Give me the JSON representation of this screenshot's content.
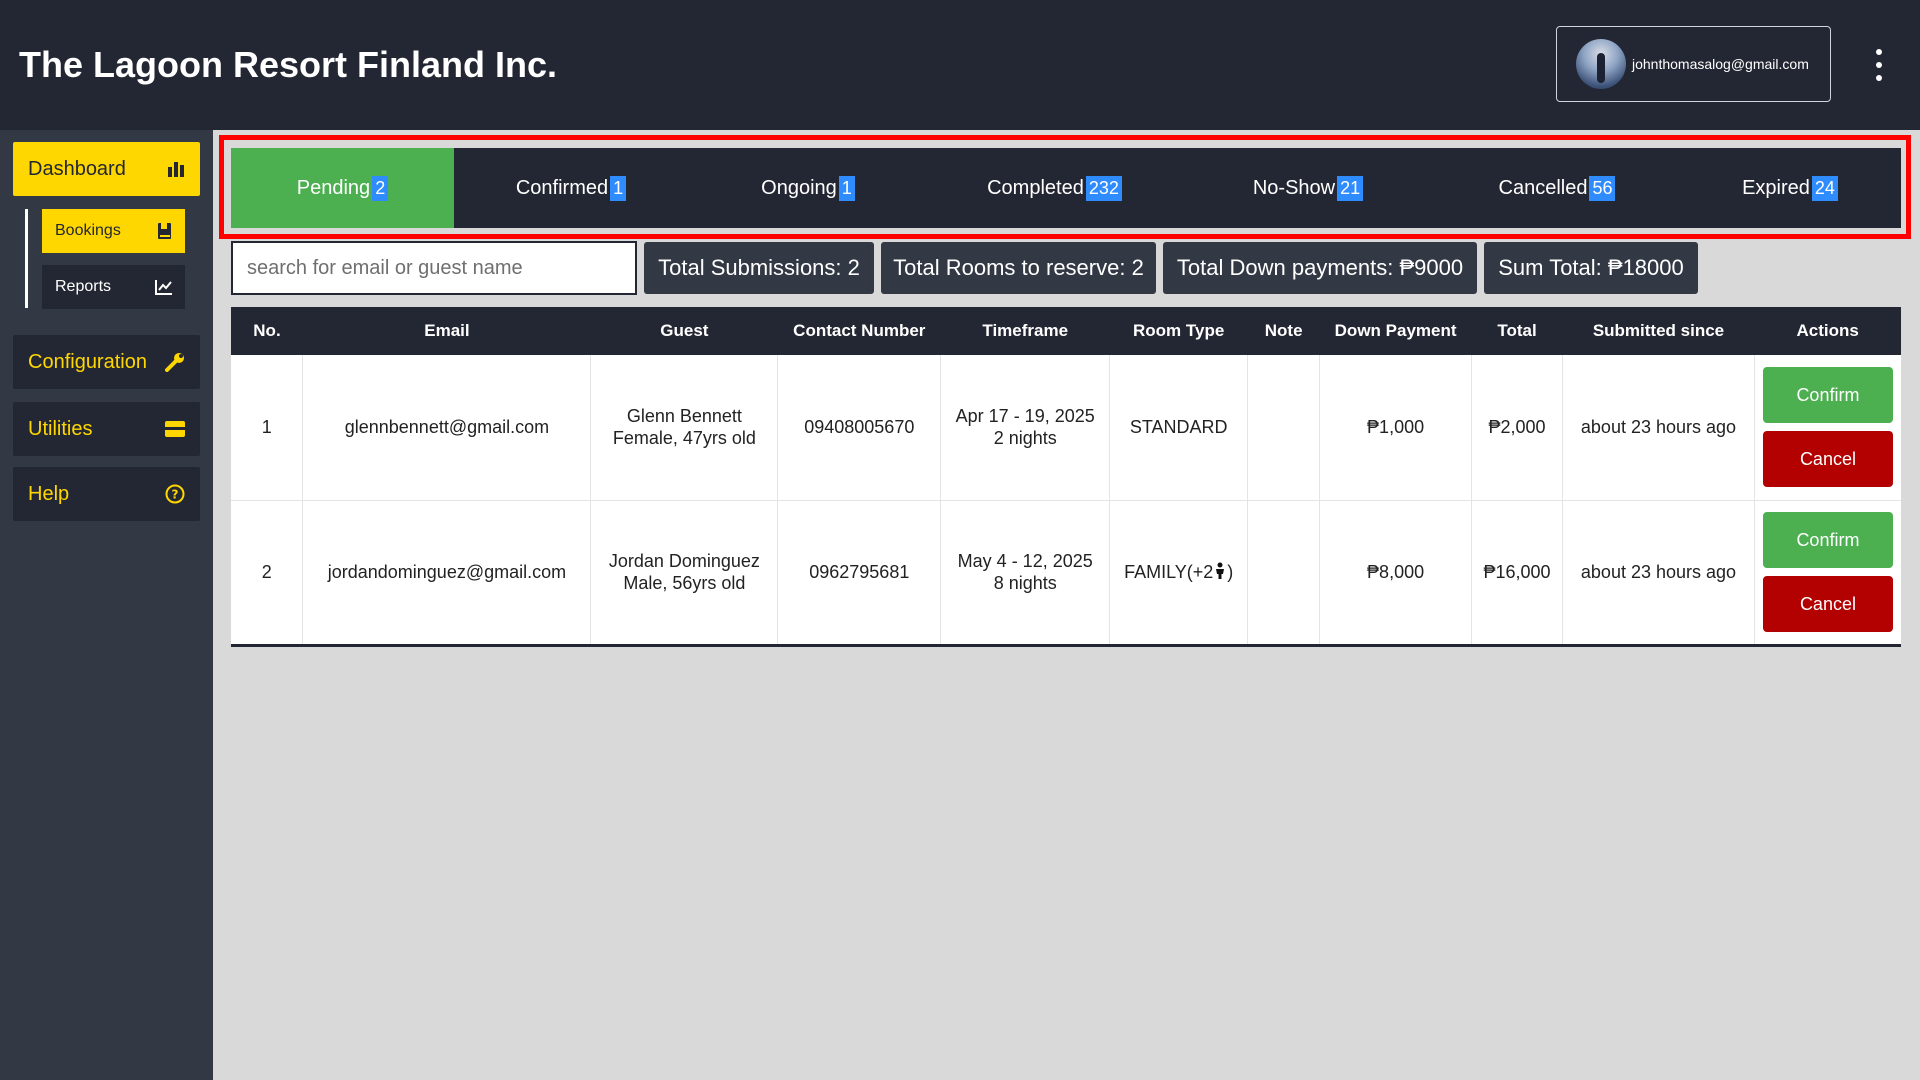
{
  "app": {
    "title": "The Lagoon Resort Finland Inc."
  },
  "account": {
    "email": "johnthomasalog@gmail.com"
  },
  "sidebar": {
    "items": [
      {
        "label": "Dashboard",
        "icon": "bar-chart-icon",
        "active": true
      },
      {
        "label": "Configuration",
        "icon": "wrench-icon"
      },
      {
        "label": "Utilities",
        "icon": "card-icon"
      },
      {
        "label": "Help",
        "icon": "help-circle-icon"
      }
    ],
    "subitems": [
      {
        "label": "Bookings",
        "icon": "book-icon",
        "active": true
      },
      {
        "label": "Reports",
        "icon": "line-chart-icon"
      }
    ]
  },
  "tabs": [
    {
      "label": "Pending",
      "count": "2",
      "active": true
    },
    {
      "label": "Confirmed",
      "count": "1"
    },
    {
      "label": "Ongoing",
      "count": "1"
    },
    {
      "label": "Completed",
      "count": "232"
    },
    {
      "label": "No-Show",
      "count": "21"
    },
    {
      "label": "Cancelled",
      "count": "56"
    },
    {
      "label": "Expired",
      "count": "24"
    }
  ],
  "search": {
    "placeholder": "search for email or guest name",
    "value": ""
  },
  "stats": {
    "submissions": "Total Submissions: 2",
    "rooms": "Total Rooms to reserve: 2",
    "downpayments": "Total Down payments: ₱9000",
    "sum": "Sum Total: ₱18000"
  },
  "table": {
    "headers": [
      "No.",
      "Email",
      "Guest",
      "Contact Number",
      "Timeframe",
      "Room Type",
      "Note",
      "Down Payment",
      "Total",
      "Submitted since",
      "Actions"
    ],
    "rows": [
      {
        "no": "1",
        "email": "glennbennett@gmail.com",
        "guest_name": "Glenn Bennett",
        "guest_info": "Female, 47yrs old",
        "contact": "09408005670",
        "dates": "Apr 17 - 19, 2025",
        "nights": "2 nights",
        "room_type": "STANDARD",
        "note": "",
        "down_payment": "₱1,000",
        "total": "₱2,000",
        "submitted": "about 23 hours ago",
        "confirm_label": "Confirm",
        "cancel_label": "Cancel"
      },
      {
        "no": "2",
        "email": "jordandominguez@gmail.com",
        "guest_name": "Jordan Dominguez",
        "guest_info": "Male, 56yrs old",
        "contact": "0962795681",
        "dates": "May 4 - 12, 2025",
        "nights": "8 nights",
        "room_type": "FAMILY(+2",
        "room_type_suffix": ")",
        "note": "",
        "down_payment": "₱8,000",
        "total": "₱16,000",
        "submitted": "about 23 hours ago",
        "confirm_label": "Confirm",
        "cancel_label": "Cancel"
      }
    ]
  }
}
